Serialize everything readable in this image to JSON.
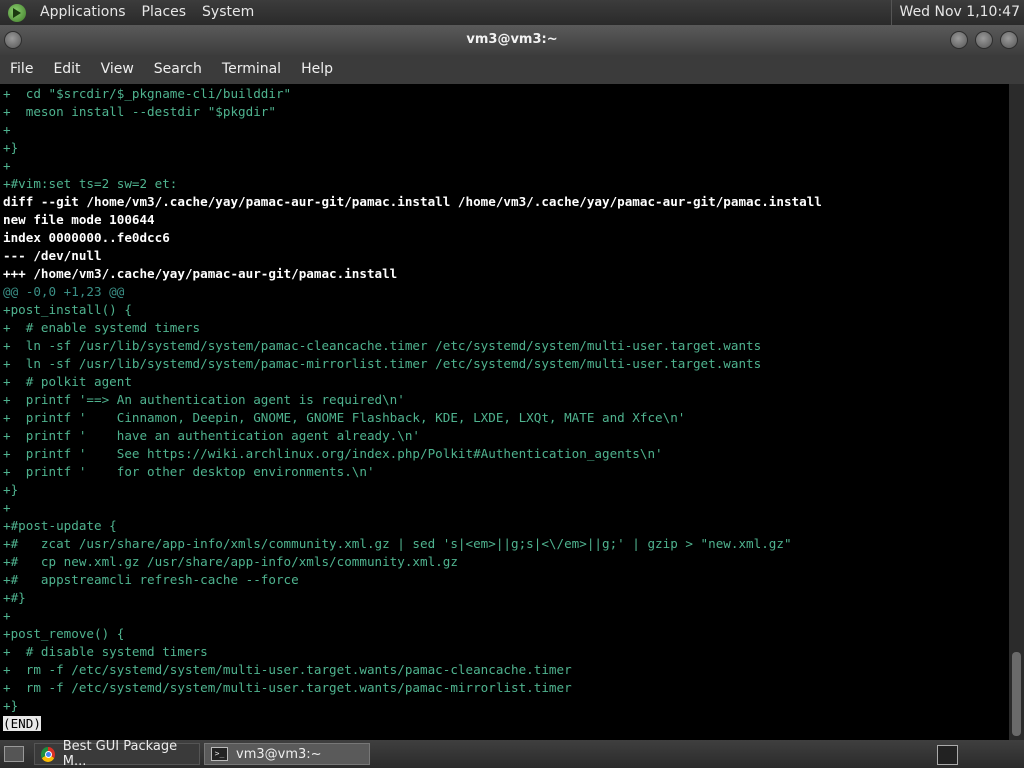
{
  "top_panel": {
    "menus": [
      "Applications",
      "Places",
      "System"
    ],
    "clock": "Wed Nov 1,10:47"
  },
  "window": {
    "title": "vm3@vm3:~",
    "menubar": [
      "File",
      "Edit",
      "View",
      "Search",
      "Terminal",
      "Help"
    ]
  },
  "terminal": {
    "lines": [
      {
        "text": "+  cd \"$srcdir/$_pkgname-cli/builddir\"",
        "style": "add"
      },
      {
        "text": "+  meson install --destdir \"$pkgdir\"",
        "style": "add"
      },
      {
        "text": "+",
        "style": "add"
      },
      {
        "text": "+}",
        "style": "add"
      },
      {
        "text": "+",
        "style": "add"
      },
      {
        "text": "+#vim:set ts=2 sw=2 et:",
        "style": "add"
      },
      {
        "text": "diff --git /home/vm3/.cache/yay/pamac-aur-git/pamac.install /home/vm3/.cache/yay/pamac-aur-git/pamac.install",
        "style": "meta"
      },
      {
        "text": "new file mode 100644",
        "style": "meta"
      },
      {
        "text": "index 0000000..fe0dcc6",
        "style": "meta"
      },
      {
        "text": "--- /dev/null",
        "style": "meta"
      },
      {
        "text": "+++ /home/vm3/.cache/yay/pamac-aur-git/pamac.install",
        "style": "meta"
      },
      {
        "text": "@@ -0,0 +1,23 @@",
        "style": "hunk"
      },
      {
        "text": "+post_install() {",
        "style": "add"
      },
      {
        "text": "+  # enable systemd timers",
        "style": "add"
      },
      {
        "text": "+  ln -sf /usr/lib/systemd/system/pamac-cleancache.timer /etc/systemd/system/multi-user.target.wants",
        "style": "add"
      },
      {
        "text": "+  ln -sf /usr/lib/systemd/system/pamac-mirrorlist.timer /etc/systemd/system/multi-user.target.wants",
        "style": "add"
      },
      {
        "text": "+  # polkit agent",
        "style": "add"
      },
      {
        "text": "+  printf '==> An authentication agent is required\\n'",
        "style": "add"
      },
      {
        "text": "+  printf '    Cinnamon, Deepin, GNOME, GNOME Flashback, KDE, LXDE, LXQt, MATE and Xfce\\n'",
        "style": "add"
      },
      {
        "text": "+  printf '    have an authentication agent already.\\n'",
        "style": "add"
      },
      {
        "text": "+  printf '    See https://wiki.archlinux.org/index.php/Polkit#Authentication_agents\\n'",
        "style": "add"
      },
      {
        "text": "+  printf '    for other desktop environments.\\n'",
        "style": "add"
      },
      {
        "text": "+}",
        "style": "add"
      },
      {
        "text": "+",
        "style": "add"
      },
      {
        "text": "+#post-update {",
        "style": "add"
      },
      {
        "text": "+#   zcat /usr/share/app-info/xmls/community.xml.gz | sed 's|<em>||g;s|<\\/em>||g;' | gzip > \"new.xml.gz\"",
        "style": "add"
      },
      {
        "text": "+#   cp new.xml.gz /usr/share/app-info/xmls/community.xml.gz",
        "style": "add"
      },
      {
        "text": "+#   appstreamcli refresh-cache --force",
        "style": "add"
      },
      {
        "text": "+#}",
        "style": "add"
      },
      {
        "text": "+",
        "style": "add"
      },
      {
        "text": "+post_remove() {",
        "style": "add"
      },
      {
        "text": "+  # disable systemd timers",
        "style": "add"
      },
      {
        "text": "+  rm -f /etc/systemd/system/multi-user.target.wants/pamac-cleancache.timer",
        "style": "add"
      },
      {
        "text": "+  rm -f /etc/systemd/system/multi-user.target.wants/pamac-mirrorlist.timer",
        "style": "add"
      },
      {
        "text": "+}",
        "style": "add"
      },
      {
        "text": "(END)",
        "style": "end"
      }
    ]
  },
  "taskbar": {
    "tasks": [
      {
        "label": "Best GUI Package M...",
        "icon": "chrome-icon",
        "active": false
      },
      {
        "label": "vm3@vm3:~",
        "icon": "terminal-icon",
        "active": true
      }
    ]
  }
}
